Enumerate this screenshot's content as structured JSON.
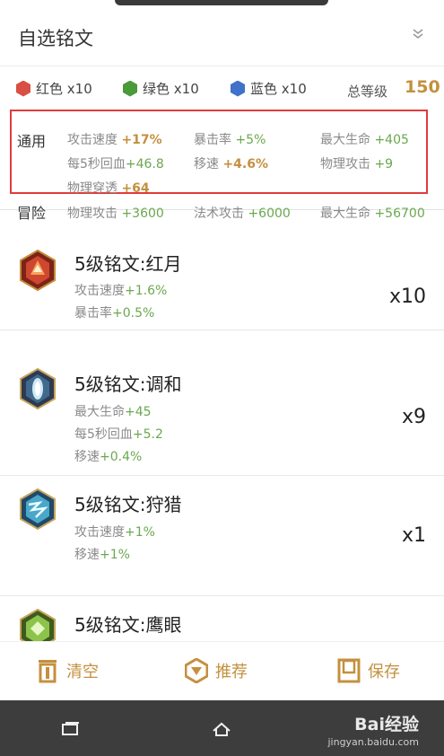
{
  "header": {
    "title": "自选铭文"
  },
  "colors": {
    "items": [
      {
        "label": "红色 x10",
        "color": "#d94f45"
      },
      {
        "label": "绿色 x10",
        "color": "#4a9a3a"
      },
      {
        "label": "蓝色 x10",
        "color": "#3f72c8"
      }
    ],
    "total_label": "总等级",
    "total_value": "150"
  },
  "general": {
    "label": "通用",
    "attrs": [
      {
        "name": "攻击速度",
        "value": "+17%"
      },
      {
        "name": "暴击率",
        "value": "+5%"
      },
      {
        "name": "最大生命",
        "value": "+405"
      },
      {
        "name": "每5秒回血",
        "value": "+46.8"
      },
      {
        "name": "移速",
        "value": "+4.6%"
      },
      {
        "name": "物理攻击",
        "value": "+9"
      },
      {
        "name": "物理穿透",
        "value": "+64"
      }
    ]
  },
  "adventure": {
    "label": "冒险",
    "attrs": [
      {
        "name": "物理攻击",
        "value": "+3600"
      },
      {
        "name": "法术攻击",
        "value": "+6000"
      },
      {
        "name": "最大生命",
        "value": "+56700"
      }
    ]
  },
  "runes": [
    {
      "name": "5级铭文:红月",
      "stats": [
        {
          "name": "攻击速度",
          "value": "+1.6%"
        },
        {
          "name": "暴击率",
          "value": "+0.5%"
        }
      ],
      "qty": "x10",
      "icon": "red-moon-rune-icon"
    },
    {
      "name": "5级铭文:调和",
      "stats": [
        {
          "name": "最大生命",
          "value": "+45"
        },
        {
          "name": "每5秒回血",
          "value": "+5.2"
        },
        {
          "name": "移速",
          "value": "+0.4%"
        }
      ],
      "qty": "x9",
      "icon": "harmony-rune-icon"
    },
    {
      "name": "5级铭文:狩猎",
      "stats": [
        {
          "name": "攻击速度",
          "value": "+1%"
        },
        {
          "name": "移速",
          "value": "+1%"
        }
      ],
      "qty": "x1",
      "icon": "hunting-rune-icon"
    },
    {
      "name": "5级铭文:鹰眼",
      "stats": [],
      "qty": "",
      "icon": "eagle-eye-rune-icon"
    }
  ],
  "bottom_bar": {
    "clear": "清空",
    "recommend": "推荐",
    "save": "保存"
  },
  "watermark": {
    "brand": "Bai经验",
    "url": "jingyan.baidu.com"
  }
}
